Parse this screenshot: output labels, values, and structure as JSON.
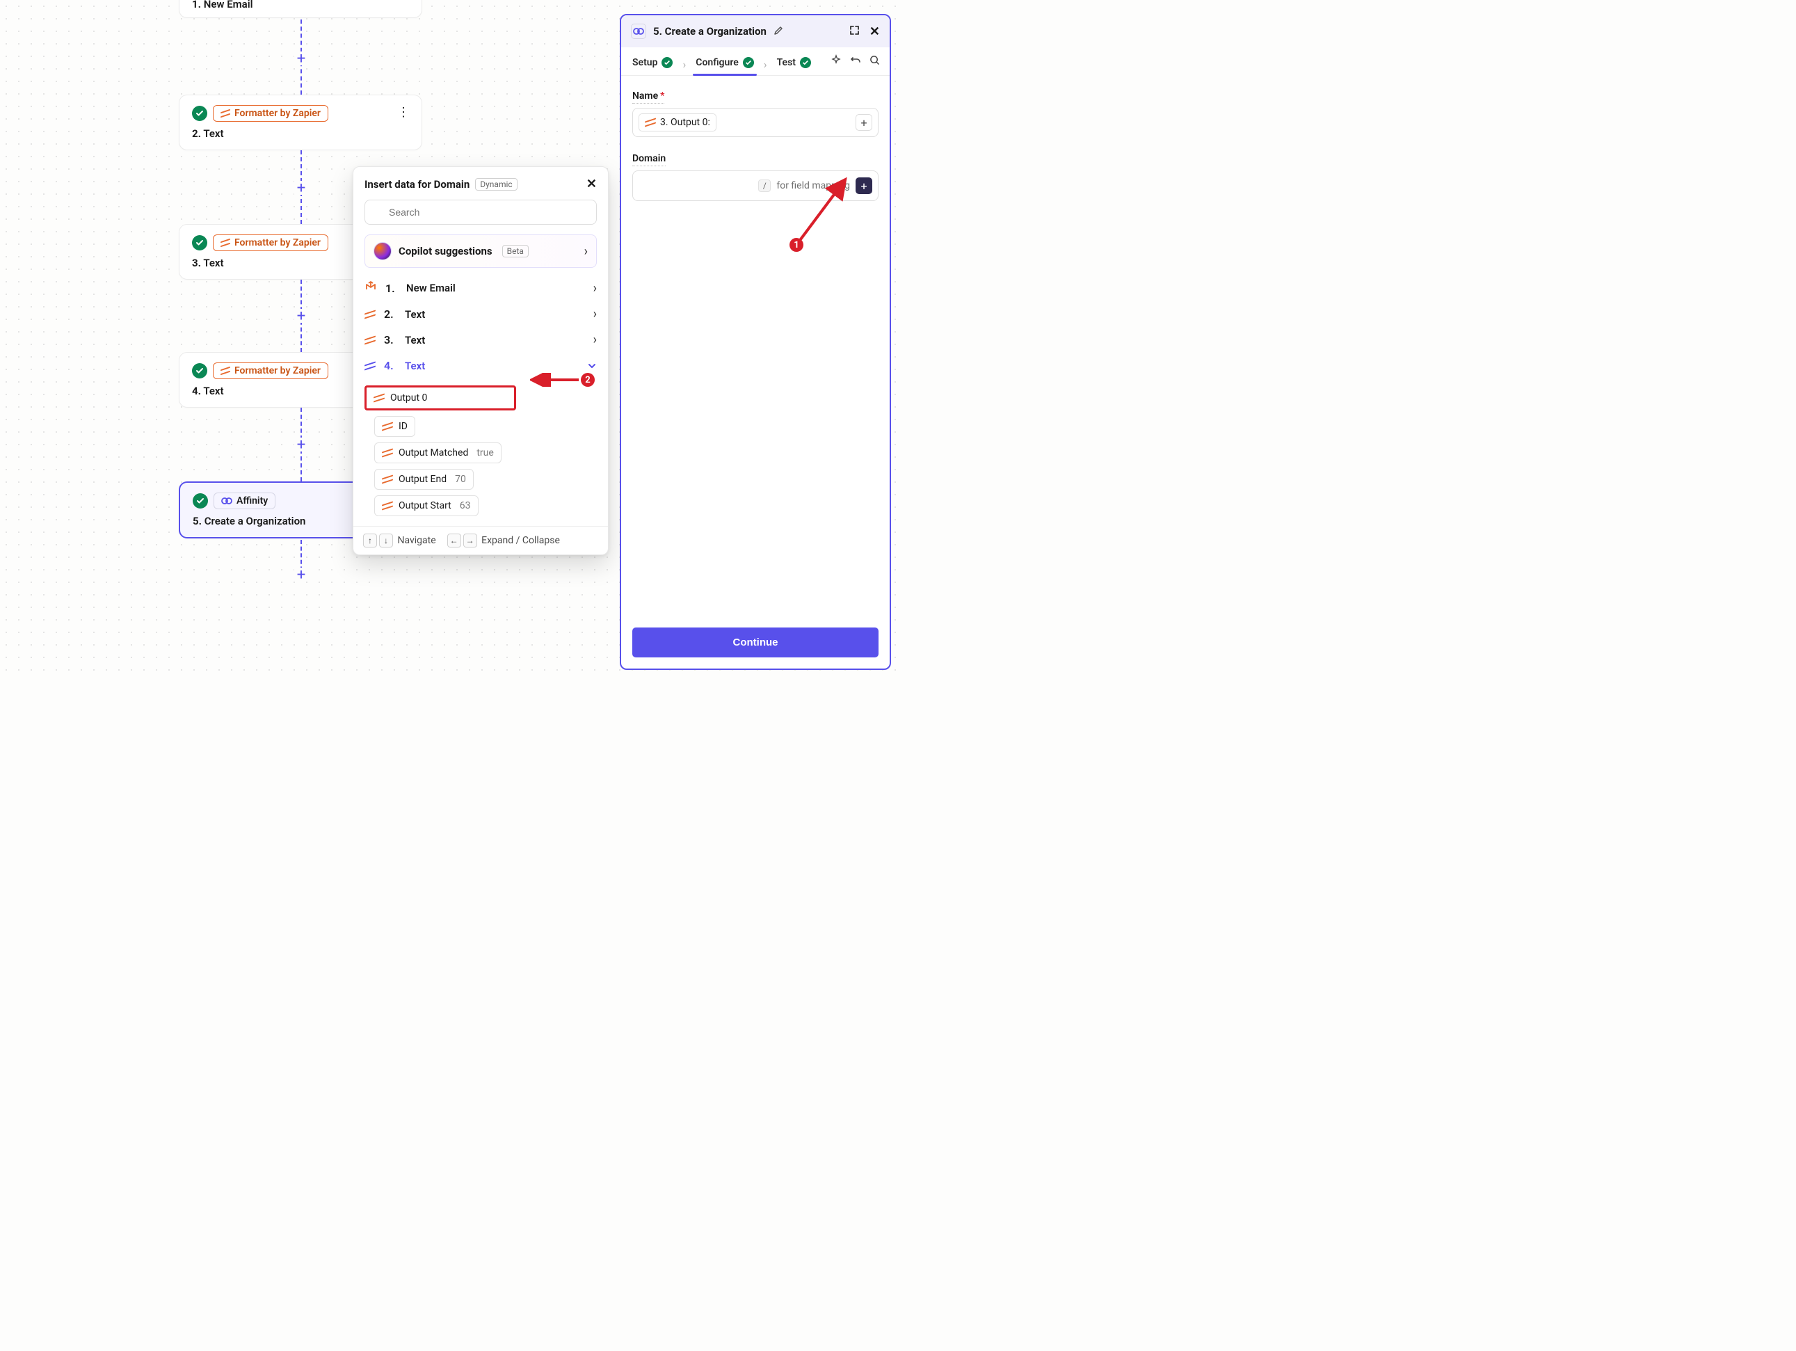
{
  "canvas": {
    "steps": [
      {
        "num": "1.",
        "title": "New Email"
      },
      {
        "num": "2.",
        "title": "Text",
        "app": "Formatter by Zapier"
      },
      {
        "num": "3.",
        "title": "Text",
        "app": "Formatter by Zapier"
      },
      {
        "num": "4.",
        "title": "Text",
        "app": "Formatter by Zapier"
      },
      {
        "num": "5.",
        "title": "Create a Organization",
        "app": "Affinity"
      }
    ]
  },
  "popover": {
    "title": "Insert data for Domain",
    "badge": "Dynamic",
    "search_placeholder": "Search",
    "copilot": {
      "title": "Copilot suggestions",
      "badge": "Beta"
    },
    "sources": [
      {
        "num": "1.",
        "label": "New Email"
      },
      {
        "num": "2.",
        "label": "Text"
      },
      {
        "num": "3.",
        "label": "Text"
      },
      {
        "num": "4.",
        "label": "Text"
      }
    ],
    "outputs": [
      {
        "label": "Output 0",
        "value": ""
      },
      {
        "label": "ID",
        "value": ""
      },
      {
        "label": "Output Matched",
        "value": "true"
      },
      {
        "label": "Output End",
        "value": "70"
      },
      {
        "label": "Output Start",
        "value": "63"
      }
    ],
    "footer": {
      "nav": "Navigate",
      "expand": "Expand / Collapse"
    }
  },
  "panel": {
    "title": "5. Create a Organization",
    "tabs": {
      "setup": "Setup",
      "configure": "Configure",
      "test": "Test"
    },
    "fields": {
      "name_label": "Name",
      "name_token": "3. Output 0:",
      "domain_label": "Domain",
      "domain_hint": "for field mapping"
    },
    "continue": "Continue"
  },
  "callouts": {
    "one": "1",
    "two": "2"
  }
}
